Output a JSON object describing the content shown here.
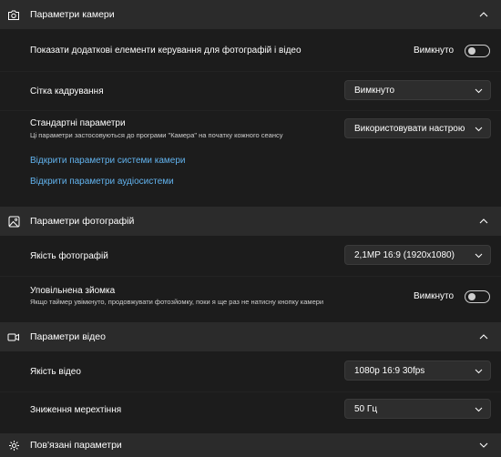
{
  "camera_section": {
    "title": "Параметри камери",
    "show_controls": {
      "label": "Показати додаткові елементи керування для фотографій і відео",
      "state_text": "Вимкнуто"
    },
    "grid": {
      "label": "Сітка кадрування",
      "value": "Вимкнуто"
    },
    "defaults": {
      "label": "Стандартні параметри",
      "description": "Ці параметри застосовуються до програми \"Камера\" на початку кожного сеансу",
      "value": "Використовувати настрою"
    },
    "links": {
      "camera_settings": "Відкрити параметри системи камери",
      "audio_settings": "Відкрити параметри аудіосистеми"
    }
  },
  "photo_section": {
    "title": "Параметри фотографій",
    "quality": {
      "label": "Якість фотографій",
      "value": "2,1MP 16:9 (1920x1080)"
    },
    "burst": {
      "label": "Уповільнена зйомка",
      "description": "Якщо таймер увімкнуто, продовжувати фотозйомку, поки я ще раз не натисну кнопку камери",
      "state_text": "Вимкнуто"
    }
  },
  "video_section": {
    "title": "Параметри відео",
    "quality": {
      "label": "Якість відео",
      "value": "1080p 16:9 30fps"
    },
    "flicker": {
      "label": "Зниження мерехтіння",
      "value": "50 Гц"
    }
  },
  "related_section": {
    "title": "Пов'язані параметри"
  },
  "colors": {
    "background": "#1c1c1c",
    "header": "#2b2b2b",
    "link": "#62b3ee"
  }
}
